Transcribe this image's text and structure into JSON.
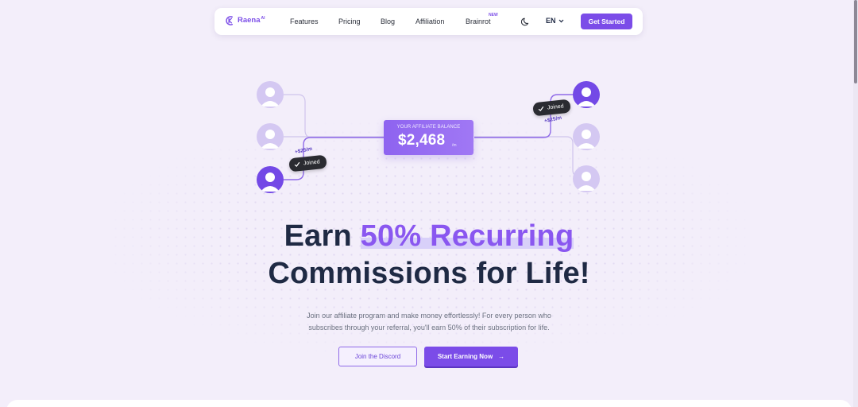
{
  "nav": {
    "logo_text": "Raena",
    "logo_sup": "AI",
    "links": [
      {
        "label": "Features"
      },
      {
        "label": "Pricing"
      },
      {
        "label": "Blog"
      },
      {
        "label": "Affiliation"
      },
      {
        "label": "Brainrot"
      }
    ],
    "new_badge": "NEW",
    "language": "EN",
    "cta_label": "Get Started"
  },
  "illustration": {
    "balance_label": "YOUR AFFILIATE BALANCE",
    "balance_value": "$2,468",
    "balance_unit": "/m",
    "joined_left": "Joined",
    "joined_right": "Joined",
    "rate_left": "+$25/m",
    "rate_right": "+$25/m"
  },
  "hero": {
    "headline_prefix": "Earn ",
    "headline_accent": "50% Recurring",
    "headline_line2": "Commissions for Life!",
    "subtext_line1": "Join our affiliate program and make money effortlessly! For every person who",
    "subtext_line2": "subscribes through your referral, you'll earn 50% of their subscription for life.",
    "discord_button": "Join the Discord",
    "start_button": "Start Earning Now",
    "start_arrow": "→"
  },
  "colors": {
    "accent": "#7b4ce8",
    "background": "#f3eefa",
    "heading": "#1f2a44"
  },
  "icons": [
    "logo-icon",
    "moon-icon",
    "chevron-down-icon",
    "check-icon",
    "user-icon",
    "arrow-right-icon"
  ]
}
